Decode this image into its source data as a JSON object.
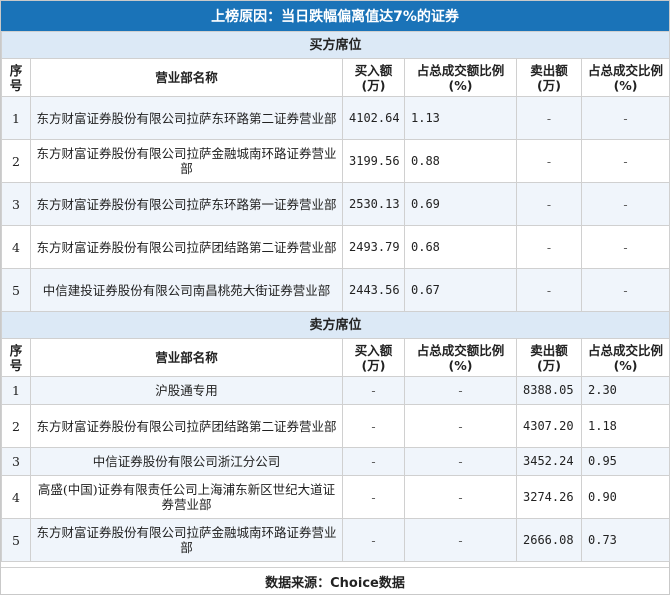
{
  "title": "上榜原因：当日跌幅偏离值达7%的证券",
  "headers": {
    "seq": "序号",
    "name": "营业部名称",
    "buy_amount": "买入额(万)",
    "buy_ratio": "占总成交额比例(%)",
    "sell_amount": "卖出额(万)",
    "sell_ratio": "占总成交比例(%)"
  },
  "buy_section": {
    "title": "买方席位",
    "rows": [
      {
        "seq": "1",
        "name": "东方财富证券股份有限公司拉萨东环路第二证券营业部",
        "buy_amount": "4102.64",
        "buy_ratio": "1.13",
        "sell_amount": "-",
        "sell_ratio": "-"
      },
      {
        "seq": "2",
        "name": "东方财富证券股份有限公司拉萨金融城南环路证券营业部",
        "buy_amount": "3199.56",
        "buy_ratio": "0.88",
        "sell_amount": "-",
        "sell_ratio": "-"
      },
      {
        "seq": "3",
        "name": "东方财富证券股份有限公司拉萨东环路第一证券营业部",
        "buy_amount": "2530.13",
        "buy_ratio": "0.69",
        "sell_amount": "-",
        "sell_ratio": "-"
      },
      {
        "seq": "4",
        "name": "东方财富证券股份有限公司拉萨团结路第二证券营业部",
        "buy_amount": "2493.79",
        "buy_ratio": "0.68",
        "sell_amount": "-",
        "sell_ratio": "-"
      },
      {
        "seq": "5",
        "name": "中信建投证券股份有限公司南昌桃苑大街证券营业部",
        "buy_amount": "2443.56",
        "buy_ratio": "0.67",
        "sell_amount": "-",
        "sell_ratio": "-"
      }
    ]
  },
  "sell_section": {
    "title": "卖方席位",
    "rows": [
      {
        "seq": "1",
        "name": "沪股通专用",
        "buy_amount": "-",
        "buy_ratio": "-",
        "sell_amount": "8388.05",
        "sell_ratio": "2.30"
      },
      {
        "seq": "2",
        "name": "东方财富证券股份有限公司拉萨团结路第二证券营业部",
        "buy_amount": "-",
        "buy_ratio": "-",
        "sell_amount": "4307.20",
        "sell_ratio": "1.18"
      },
      {
        "seq": "3",
        "name": "中信证券股份有限公司浙江分公司",
        "buy_amount": "-",
        "buy_ratio": "-",
        "sell_amount": "3452.24",
        "sell_ratio": "0.95"
      },
      {
        "seq": "4",
        "name": "高盛(中国)证券有限责任公司上海浦东新区世纪大道证券营业部",
        "buy_amount": "-",
        "buy_ratio": "-",
        "sell_amount": "3274.26",
        "sell_ratio": "0.90"
      },
      {
        "seq": "5",
        "name": "东方财富证券股份有限公司拉萨金融城南环路证券营业部",
        "buy_amount": "-",
        "buy_ratio": "-",
        "sell_amount": "2666.08",
        "sell_ratio": "0.73"
      }
    ]
  },
  "footer": "数据来源：Choice数据",
  "colors": {
    "title_bg": "#1a73b8",
    "section_bg": "#dce9f6",
    "row_alt_bg": "#f0f5fb"
  }
}
